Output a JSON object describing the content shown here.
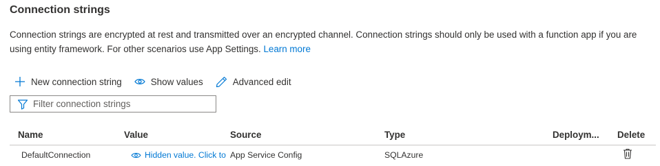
{
  "section": {
    "title": "Connection strings",
    "description": "Connection strings are encrypted at rest and transmitted over an encrypted channel. Connection strings should only be used with a function app if you are using entity framework. For other scenarios use App Settings.",
    "learn_more": "Learn more"
  },
  "toolbar": {
    "new_label": "New connection string",
    "new_icon": "plus-icon",
    "show_label": "Show values",
    "show_icon": "eye-icon",
    "advanced_label": "Advanced edit",
    "advanced_icon": "pencil-icon"
  },
  "filter": {
    "placeholder": "Filter connection strings",
    "icon": "filter-icon"
  },
  "table": {
    "columns": [
      "Name",
      "Value",
      "Source",
      "Type",
      "Deploym...",
      "Delete"
    ],
    "rows": [
      {
        "name": "DefaultConnection",
        "value": "Hidden value. Click to show value",
        "source": "App Service Config",
        "type": "SQLAzure",
        "deployment": "",
        "delete_icon": "trash-icon"
      }
    ]
  },
  "colors": {
    "link": "#0078d4",
    "text": "#323130",
    "border": "#8a8886"
  }
}
